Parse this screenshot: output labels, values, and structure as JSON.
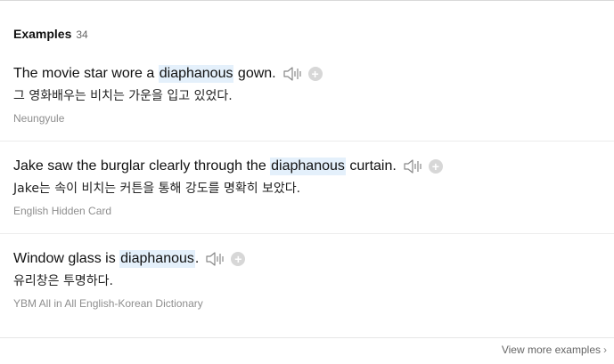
{
  "header": {
    "title": "Examples",
    "count": "34"
  },
  "examples": [
    {
      "before": "The movie star wore a ",
      "keyword": "diaphanous",
      "after": " gown.",
      "translation": "그 영화배우는 비치는 가운을 입고 있었다.",
      "source": "Neungyule"
    },
    {
      "before": "Jake saw the burglar clearly through the ",
      "keyword": "diaphanous",
      "after": " curtain.",
      "translation": "Jake는 속이 비치는 커튼을 통해 강도를 명확히 보았다.",
      "source": "English Hidden Card"
    },
    {
      "before": "Window glass is ",
      "keyword": "diaphanous",
      "after": ".",
      "translation": "유리창은 투명하다.",
      "source": "YBM All in All English-Korean Dictionary"
    }
  ],
  "icons": {
    "audio": "speaker-icon",
    "add": "plus-circle-icon"
  },
  "footer": {
    "more_label": "View more examples",
    "more_icon": "chevron-right-icon"
  },
  "colors": {
    "highlight": "#e4f0fb",
    "source_text": "#8e8e8e",
    "plus_bg": "#d7d7d7"
  }
}
